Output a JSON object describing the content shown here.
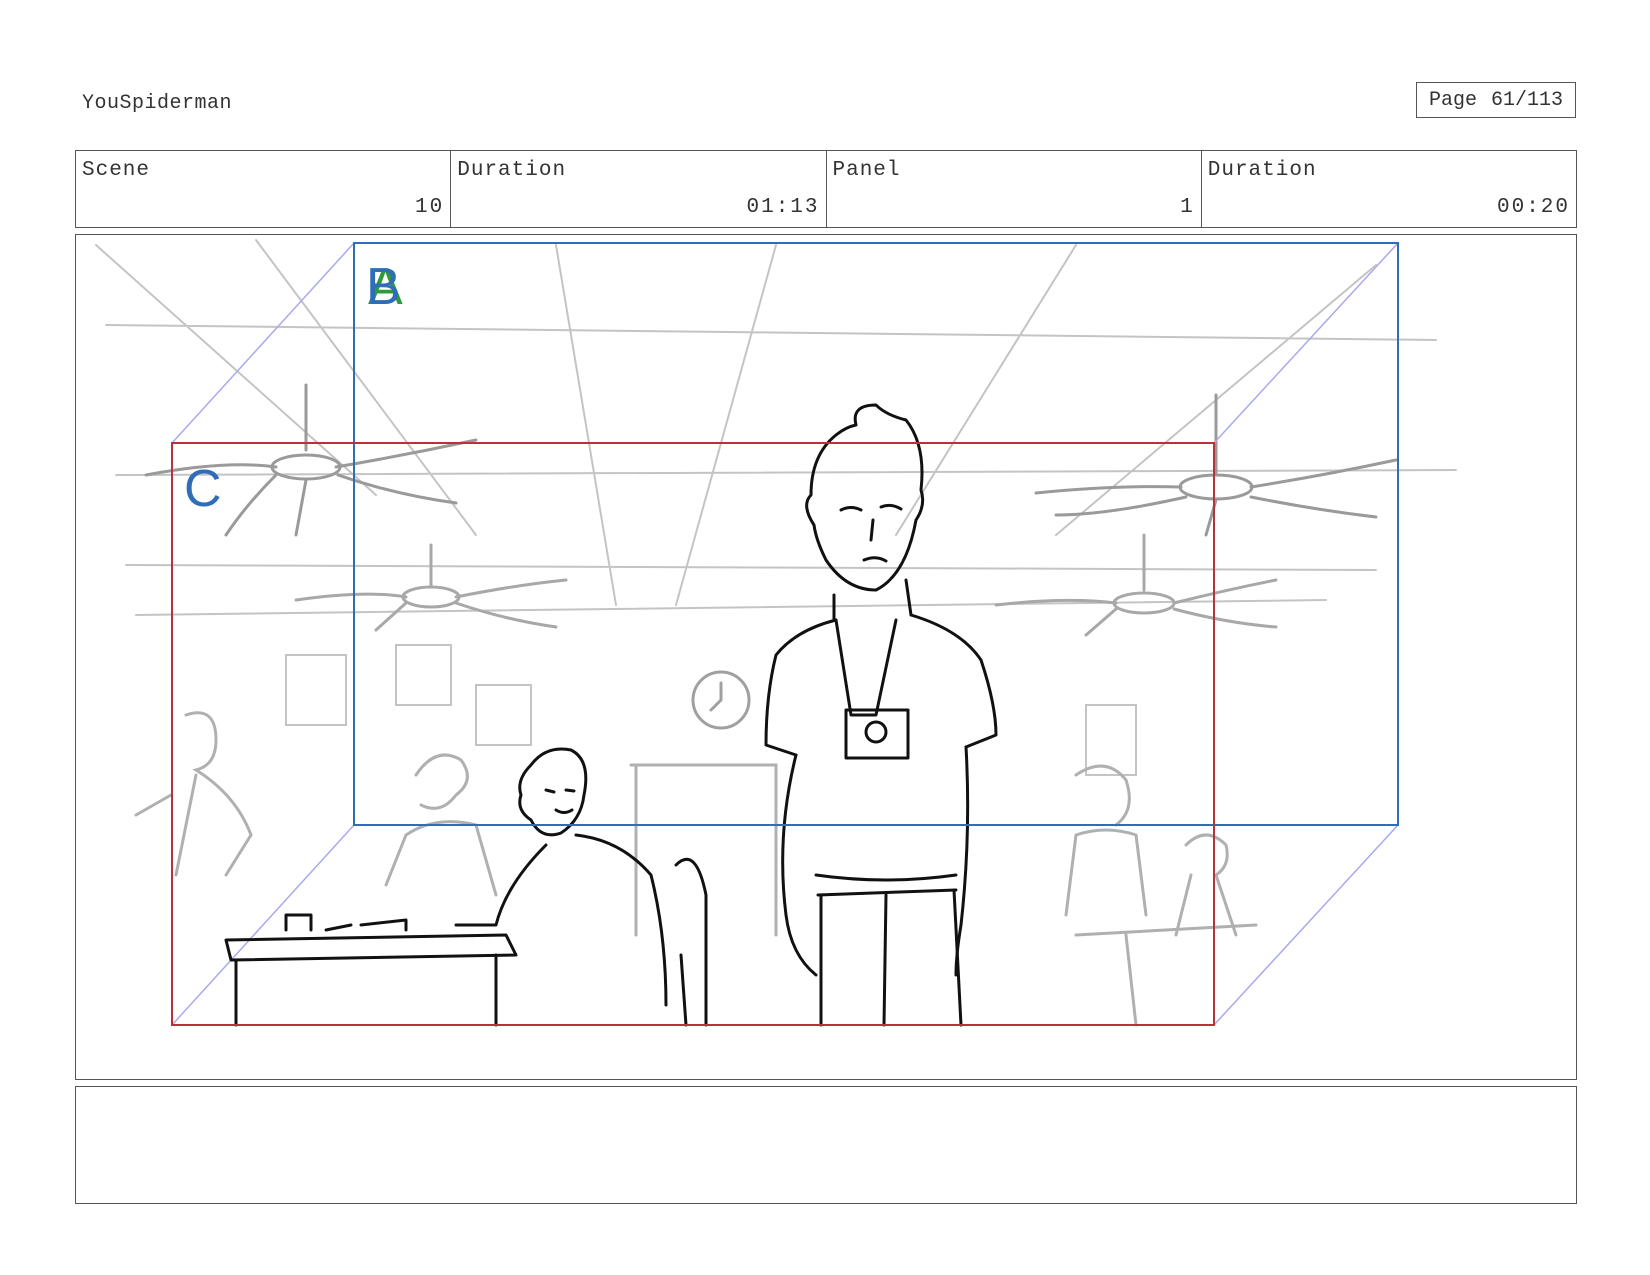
{
  "header": {
    "project_title": "YouSpiderman",
    "page_label": "Page",
    "page_number": "61/113"
  },
  "info": {
    "scene_label": "Scene",
    "scene_value": "10",
    "scene_duration_label": "Duration",
    "scene_duration_value": "01:13",
    "panel_label": "Panel",
    "panel_value": "1",
    "panel_duration_label": "Duration",
    "panel_duration_value": "00:20"
  },
  "frames": {
    "a_label": "A",
    "b_label": "B",
    "c_label": "C",
    "a_color": "#2e9b3a",
    "b_color": "#2f6db8",
    "c_color": "#b8323a"
  },
  "notes": {
    "text": ""
  }
}
